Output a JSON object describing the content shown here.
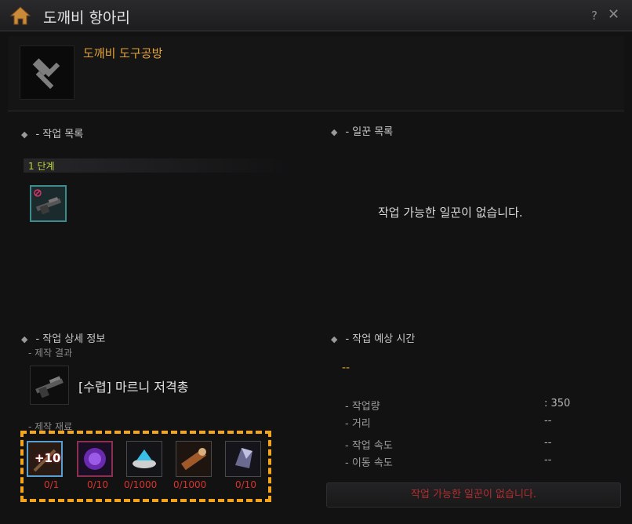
{
  "window": {
    "title": "도깨비 항아리"
  },
  "header": {
    "shop_title": "도깨비 도구공방"
  },
  "work_list": {
    "title": "- 작업 목록",
    "stage_label": "1 단계"
  },
  "worker_list": {
    "title": "- 일꾼 목록",
    "empty_message": "작업 가능한 일꾼이 없습니다."
  },
  "detail": {
    "title": "- 작업 상세 정보",
    "result_label": "- 제작 결과",
    "result_item_name": "[수렵] 마르니 저격총",
    "materials_label": "- 제작 재료",
    "materials": [
      {
        "icon": "enhance-plus10-icon",
        "badge": "+10",
        "count": "0/1"
      },
      {
        "icon": "purple-orb-icon",
        "count": "0/10"
      },
      {
        "icon": "blue-crystal-bowl-icon",
        "count": "0/1000"
      },
      {
        "icon": "wood-plank-icon",
        "count": "0/1000"
      },
      {
        "icon": "dark-crystal-icon",
        "count": "0/10"
      }
    ]
  },
  "time": {
    "title": "- 작업 예상 시간",
    "value": "--",
    "stats": [
      {
        "label": "- 작업량",
        "value": ": 350"
      },
      {
        "label": "- 거리",
        "value": "--"
      },
      {
        "label": "- 작업 속도",
        "value": "--"
      },
      {
        "label": "- 이동 속도",
        "value": "--"
      }
    ]
  },
  "action_button": {
    "label": "작업 가능한 일꾼이 없습니다."
  },
  "colors": {
    "accent_orange": "#e3a234",
    "stage_green": "#b8d63a",
    "warning_red": "#d8342c",
    "highlight_dash": "#f4a51c"
  }
}
